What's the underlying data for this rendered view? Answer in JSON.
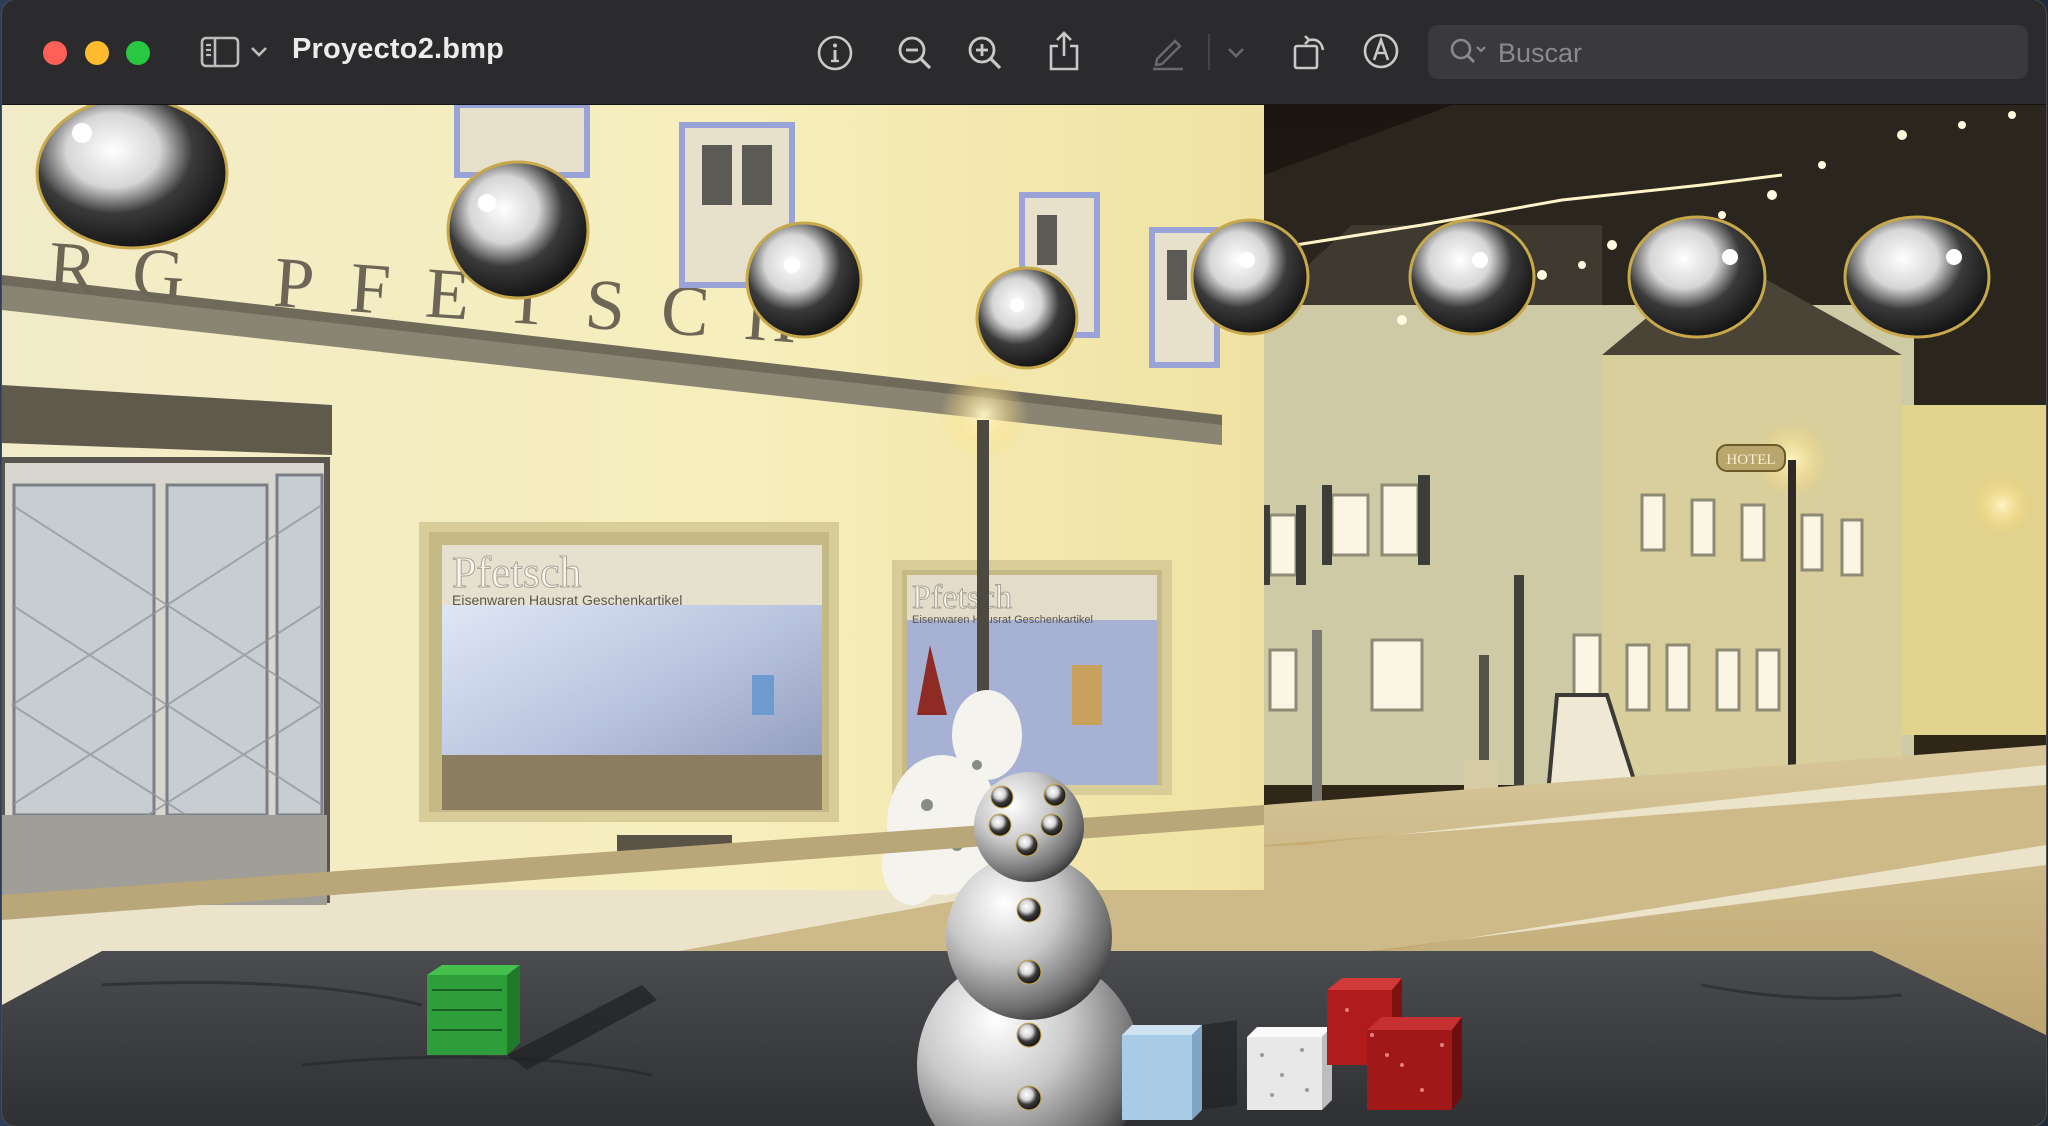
{
  "window": {
    "title": "Proyecto2.bmp"
  },
  "toolbar": {
    "icons": [
      "sidebar-toggle-icon",
      "chevron-down-icon",
      "info-icon",
      "zoom-out-icon",
      "zoom-in-icon",
      "share-icon",
      "markup-pencil-icon",
      "chevron-down-icon",
      "rotate-icon",
      "markup-toolbar-icon",
      "search-icon"
    ]
  },
  "search": {
    "placeholder": "Buscar",
    "value": ""
  },
  "image": {
    "shop_sign_text": "RG PFETSCH",
    "window_left_brand": "Pfetsch",
    "window_left_tagline": "Eisenwaren   Hausrat   Geschenkartikel",
    "window_right_brand": "Pfetsch",
    "window_right_tagline": "Eisenwaren   Hausrat   Geschenkartikel",
    "hotel_sign": "HOTEL"
  },
  "colors": {
    "titlebar": "#2b2b2d",
    "close": "#fe5f57",
    "minimize": "#febc2e",
    "zoom": "#28c840",
    "table": "#3b3d40",
    "cube_green": "#2e9e3a",
    "cube_blue": "#a8cbe6",
    "cube_white": "#e8e8e8",
    "cube_red": "#b01c1c"
  }
}
